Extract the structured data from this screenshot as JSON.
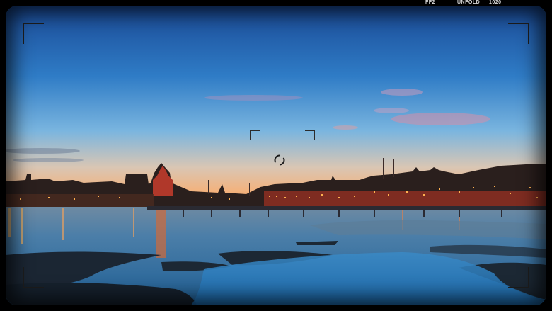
{
  "statusbar": {
    "format": "FF2",
    "mode": "UNFOLD",
    "value": "1020"
  },
  "viewfinder": {
    "scene": "city-skyline-at-dusk-over-water",
    "icons": {
      "frame_corners": "frame-corner-icon",
      "af_brackets": "af-bracket-icon",
      "focus": "focus-ring-icon"
    },
    "colors": {
      "sky_top": "#1c4f9c",
      "sky_mid": "#3f8fd0",
      "horizon": "#f0b886",
      "water": "#2f6fa2",
      "ice": "#1a2634",
      "city": "#2a1e1c",
      "lights": "#ffb35a"
    }
  }
}
